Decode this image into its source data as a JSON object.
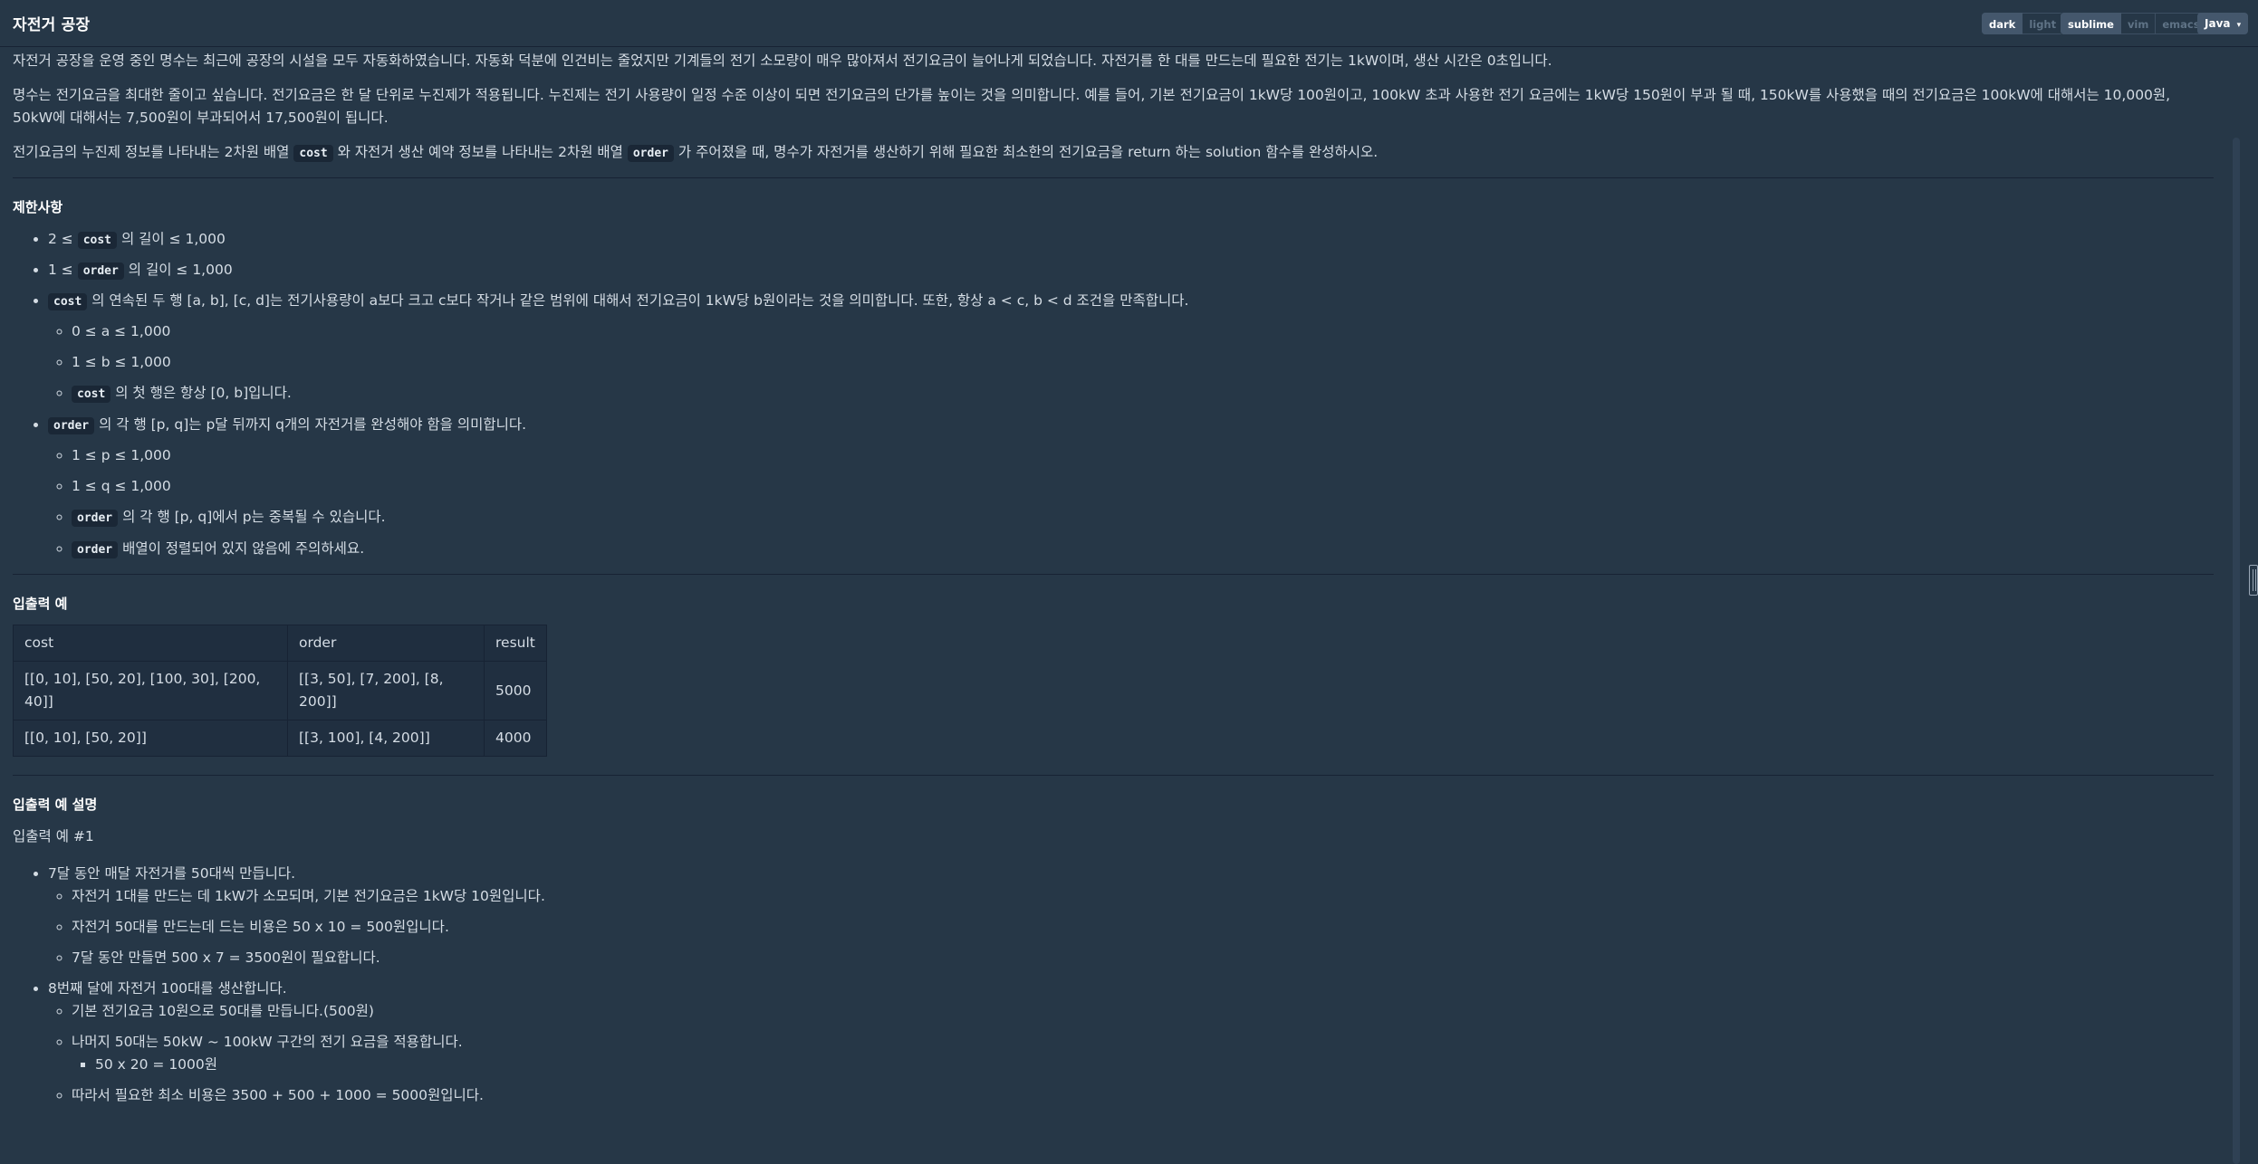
{
  "header": {
    "title": "자전거 공장",
    "theme_buttons": [
      "dark",
      "light"
    ],
    "editor_buttons": [
      "sublime",
      "vim",
      "emacs"
    ],
    "language": "Java"
  },
  "description": {
    "p1": "자전거 공장을 운영 중인 명수는 최근에 공장의 시설을 모두 자동화하였습니다. 자동화 덕분에 인건비는 줄었지만 기계들의 전기 소모량이 매우 많아져서 전기요금이 늘어나게 되었습니다. 자전거를 한 대를 만드는데 필요한 전기는 1kW이며, 생산 시간은 0초입니다.",
    "p2": "명수는 전기요금을 최대한 줄이고 싶습니다. 전기요금은 한 달 단위로 누진제가 적용됩니다. 누진제는 전기 사용량이 일정 수준 이상이 되면 전기요금의 단가를 높이는 것을 의미합니다. 예를 들어, 기본 전기요금이 1kW당 100원이고, 100kW 초과 사용한 전기 요금에는 1kW당 150원이 부과 될 때, 150kW를 사용했을 때의 전기요금은 100kW에 대해서는 10,000원, 50kW에 대해서는 7,500원이 부과되어서 17,500원이 됩니다.",
    "p3_a": "전기요금의 누진제 정보를 나타내는 2차원 배열 ",
    "p3_code1": "cost",
    "p3_b": " 와 자전거 생산 예약 정보를 나타내는 2차원 배열 ",
    "p3_code2": "order",
    "p3_c": " 가 주어졌을 때, 명수가 자전거를 생산하기 위해 필요한 최소한의 전기요금을 return 하는 solution 함수를 완성하시오."
  },
  "constraints": {
    "heading": "제한사항",
    "c1_a": "2 ≤ ",
    "c1_code": "cost",
    "c1_b": " 의 길이 ≤ 1,000",
    "c2_a": "1 ≤ ",
    "c2_code": "order",
    "c2_b": " 의 길이 ≤ 1,000",
    "c3_code": "cost",
    "c3_b": " 의 연속된 두 행 [a, b], [c, d]는 전기사용량이 a보다 크고 c보다 작거나 같은 범위에 대해서 전기요금이 1kW당 b원이라는 것을 의미합니다. 또한, 항상 a < c, b < d 조건을 만족합니다.",
    "c3_sub1": "0 ≤ a ≤ 1,000",
    "c3_sub2": "1 ≤ b ≤ 1,000",
    "c3_sub3_code": "cost",
    "c3_sub3_b": " 의 첫 행은 항상 [0, b]입니다.",
    "c4_code": "order",
    "c4_b": " 의 각 행 [p, q]는 p달 뒤까지 q개의 자전거를 완성해야 함을 의미합니다.",
    "c4_sub1": "1 ≤ p ≤ 1,000",
    "c4_sub2": "1 ≤ q ≤ 1,000",
    "c4_sub3_code": "order",
    "c4_sub3_b": " 의 각 행 [p, q]에서 p는 중복될 수 있습니다.",
    "c4_sub4_code": "order",
    "c4_sub4_b": " 배열이 정렬되어 있지 않음에 주의하세요."
  },
  "examples": {
    "heading": "입출력 예",
    "columns": [
      "cost",
      "order",
      "result"
    ],
    "rows": [
      [
        "[[0, 10], [50, 20], [100, 30], [200, 40]]",
        "[[3, 50], [7, 200], [8, 200]]",
        "5000"
      ],
      [
        "[[0, 10], [50, 20]]",
        "[[3, 100], [4, 200]]",
        "4000"
      ]
    ]
  },
  "explanation": {
    "heading": "입출력 예 설명",
    "sub_heading": "입출력 예 #1",
    "b1": "7달 동안 매달 자전거를 50대씩 만듭니다.",
    "b1_s1": "자전거 1대를 만드는 데 1kW가 소모되며, 기본 전기요금은 1kW당 10원입니다.",
    "b1_s2": "자전거 50대를 만드는데 드는 비용은 50 x 10 = 500원입니다.",
    "b1_s3": "7달 동안 만들면 500 x 7 = 3500원이 필요합니다.",
    "b2": "8번째 달에 자전거 100대를 생산합니다.",
    "b2_s1": "기본 전기요금 10원으로 50대를 만듭니다.(500원)",
    "b2_s2": "나머지 50대는 50kW ~ 100kW 구간의 전기 요금을 적용합니다.",
    "b2_s2_s1": "50 x 20 = 1000원",
    "b2_s3": "따라서 필요한 최소 비용은 3500 + 500 + 1000 = 5000원입니다."
  }
}
